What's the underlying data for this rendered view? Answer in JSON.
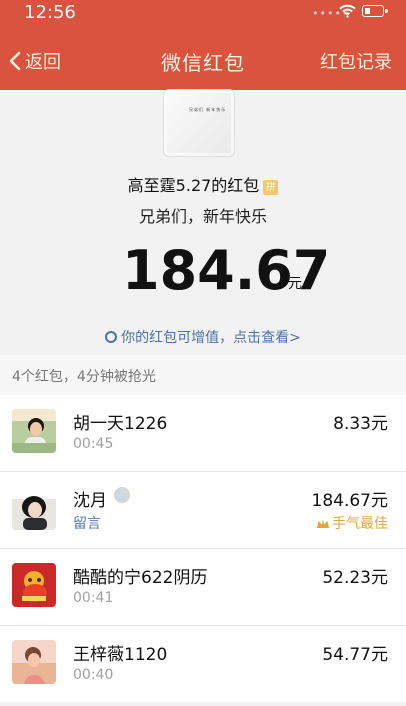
{
  "status": {
    "time": "12:56",
    "carrier_dots": "•••••"
  },
  "nav": {
    "back": "返回",
    "title": "微信红包",
    "records": "红包记录"
  },
  "cover": {
    "text": "兄弟们 新年快乐"
  },
  "packet": {
    "sender": "高至霆5.27的红包",
    "pin_label": "拼",
    "greeting": "兄弟们，新年快乐",
    "amount": "184.67",
    "unit": "元",
    "hint": "你的红包可增值，点击查看>"
  },
  "list_header": "4个红包，4分钟被抢光",
  "rows": [
    {
      "name": "胡一天1226",
      "meta": "00:45",
      "amount": "8.33元",
      "best": ""
    },
    {
      "name": "沈月",
      "meta": "留言",
      "amount": "184.67元",
      "best": "手气最佳"
    },
    {
      "name": "酷酷的宁622阴历",
      "meta": "00:41",
      "amount": "52.23元",
      "best": ""
    },
    {
      "name": "王梓薇1120",
      "meta": "00:40",
      "amount": "54.77元",
      "best": ""
    }
  ],
  "icons": {
    "back": "chevron-left-icon",
    "wifi": "wifi-icon",
    "battery": "battery-icon",
    "hint": "value-circle-icon",
    "best": "crown-icon"
  },
  "colors": {
    "header": "#d9533f",
    "link": "#4c72a7",
    "best": "#e1a63a"
  }
}
